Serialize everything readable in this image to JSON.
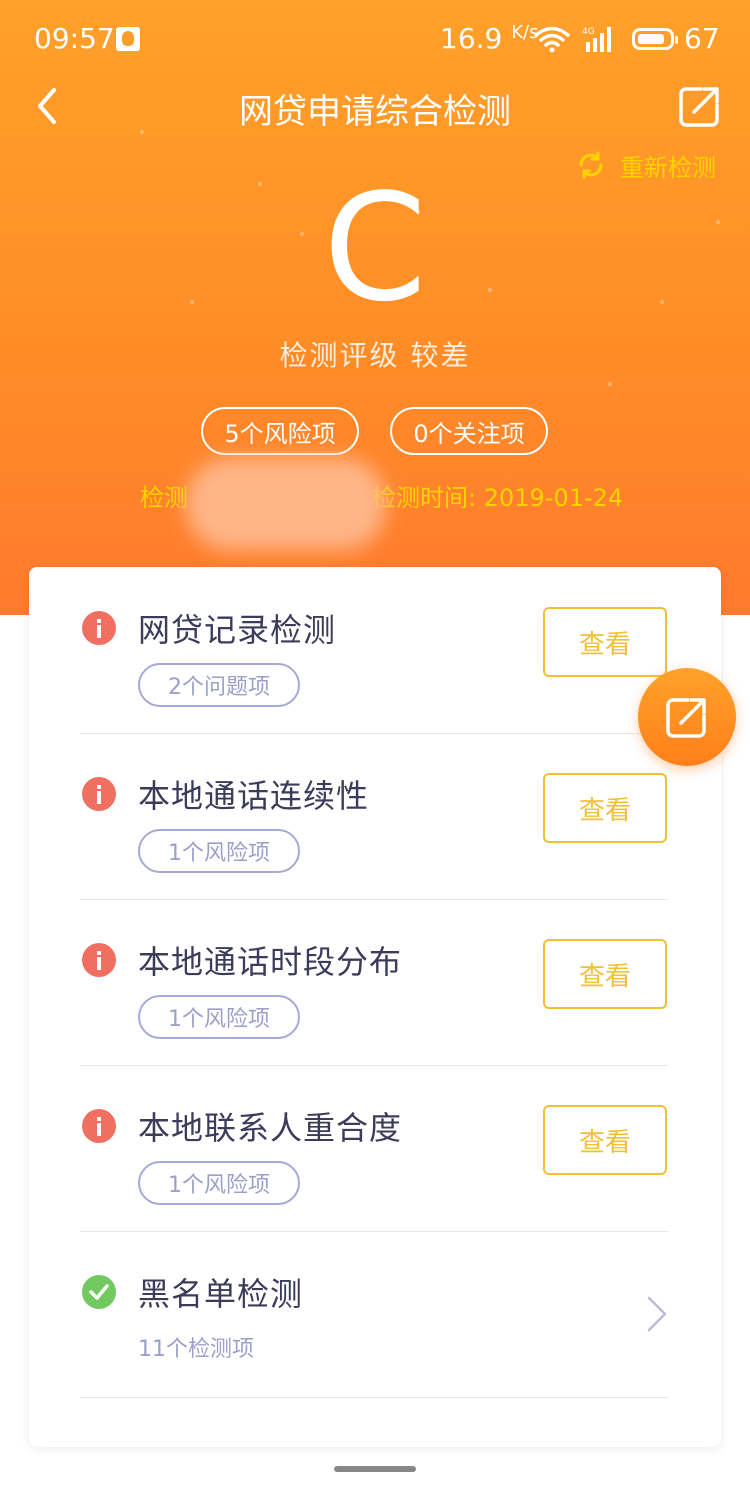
{
  "status_bar": {
    "time": "09:57",
    "speed": "16.9",
    "speed_unit": "K/s",
    "battery": "67",
    "network": "4G"
  },
  "header": {
    "title": "网贷申请综合检测",
    "recheck_label": "重新检测",
    "grade": "C",
    "grade_label": "检测评级",
    "grade_value": "较差",
    "risk_pill": "5个风险项",
    "focus_pill": "0个关注项",
    "meta_left": "检测",
    "meta_right": "检测时间: 2019-01-24"
  },
  "items": [
    {
      "label": "网贷记录检测",
      "tag": "2个问题项",
      "button": "查看",
      "status": "warn"
    },
    {
      "label": "本地通话连续性",
      "tag": "1个风险项",
      "button": "查看",
      "status": "warn"
    },
    {
      "label": "本地通话时段分布",
      "tag": "1个风险项",
      "button": "查看",
      "status": "warn"
    },
    {
      "label": "本地联系人重合度",
      "tag": "1个风险项",
      "button": "查看",
      "status": "warn"
    },
    {
      "label": "黑名单检测",
      "sub": "11个检测项",
      "status": "ok"
    }
  ],
  "colors": {
    "accent": "#ff9626",
    "warn": "#ef6f61",
    "ok": "#71c95f",
    "button": "#f2bf35"
  }
}
